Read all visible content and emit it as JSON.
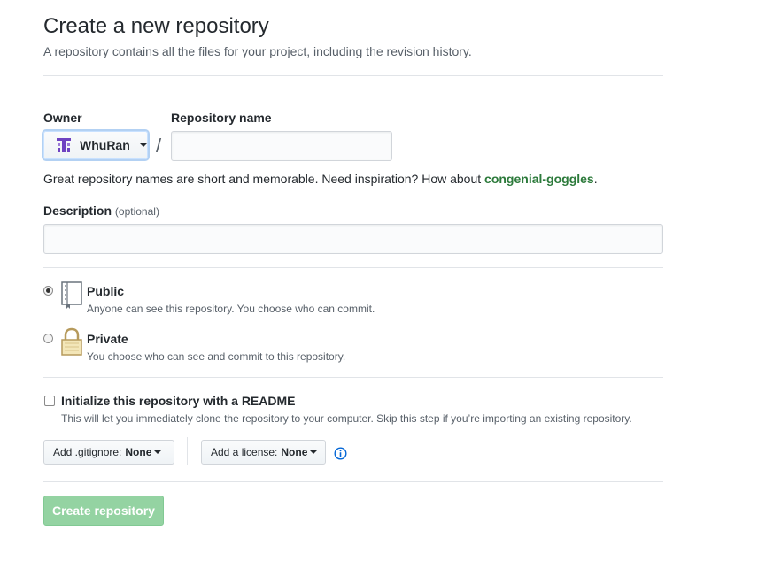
{
  "header": {
    "title": "Create a new repository",
    "subtitle": "A repository contains all the files for your project, including the revision history."
  },
  "owner": {
    "label": "Owner",
    "selected": "WhuRan",
    "avatar_color": "#6f42c1"
  },
  "separator": "/",
  "repository_name": {
    "label": "Repository name",
    "value": "",
    "placeholder": ""
  },
  "name_hint": {
    "prefix": "Great repository names are short and memorable. Need inspiration? How about ",
    "suggestion": "congenial-goggles",
    "suffix": "."
  },
  "description": {
    "label": "Description",
    "optional_label": "(optional)",
    "value": "",
    "placeholder": ""
  },
  "visibility": {
    "options": [
      {
        "label": "Public",
        "description": "Anyone can see this repository. You choose who can commit.",
        "icon": "repo-book-icon",
        "checked": true
      },
      {
        "label": "Private",
        "description": "You choose who can see and commit to this repository.",
        "icon": "lock-icon",
        "checked": false
      }
    ]
  },
  "readme": {
    "label": "Initialize this repository with a README",
    "description": "This will let you immediately clone the repository to your computer. Skip this step if you’re importing an existing repository.",
    "checked": false
  },
  "gitignore": {
    "label": "Add .gitignore:",
    "value": "None"
  },
  "license": {
    "label": "Add a license:",
    "value": "None"
  },
  "info_icon": "info-icon",
  "submit": {
    "label": "Create repository",
    "color": "#94d3a2"
  },
  "colors": {
    "link_green": "#2c7a3b",
    "info_blue": "#0366d6",
    "lock_gold": "#b69a5c"
  }
}
